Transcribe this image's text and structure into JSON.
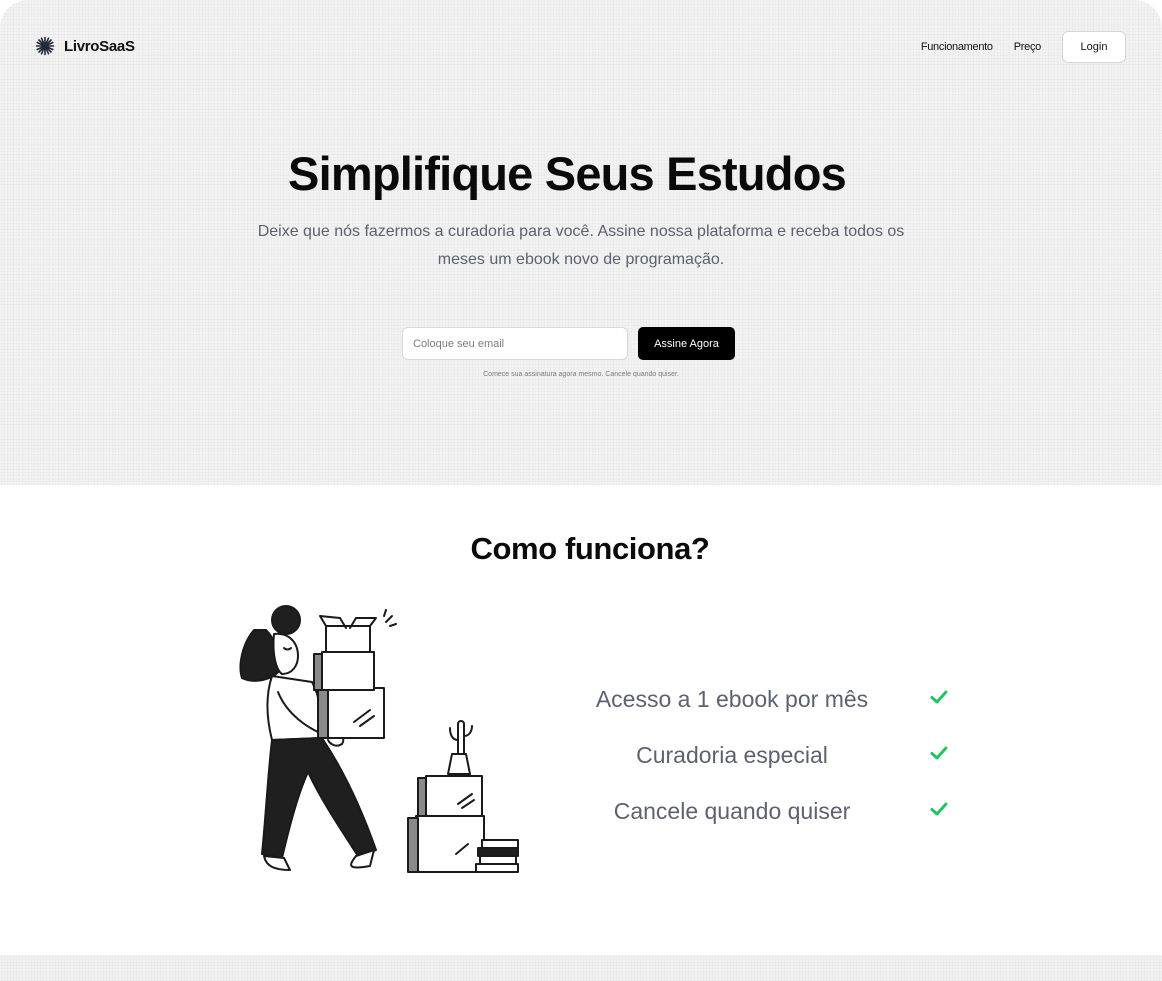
{
  "header": {
    "brand_name": "LivroSaaS",
    "brand_icon": "starburst-icon",
    "nav_links": [
      "Funcionamento",
      "Preço"
    ],
    "login_label": "Login"
  },
  "hero": {
    "title": "Simplifique Seus Estudos",
    "subtitle": "Deixe que nós fazermos a curadoria para você. Assine nossa plataforma e receba todos os meses um ebook novo de programação.",
    "email_placeholder": "Coloque seu email",
    "email_value": "",
    "cta_label": "Assine Agora",
    "fine_print": "Comece sua assinatura agora mesmo. Cancele quando quiser."
  },
  "how_it_works": {
    "title": "Como funciona?",
    "illustration": "woman-carrying-boxes-illustration",
    "features": [
      {
        "text": "Acesso a 1 ebook por mês",
        "icon": "check-icon"
      },
      {
        "text": "Curadoria especial",
        "icon": "check-icon"
      },
      {
        "text": "Cancele quando quiser",
        "icon": "check-icon"
      }
    ]
  },
  "colors": {
    "accent_check": "#22c55e",
    "cta_background": "#000000",
    "hero_background": "#f3f3f3",
    "muted_text": "#5b6170"
  }
}
